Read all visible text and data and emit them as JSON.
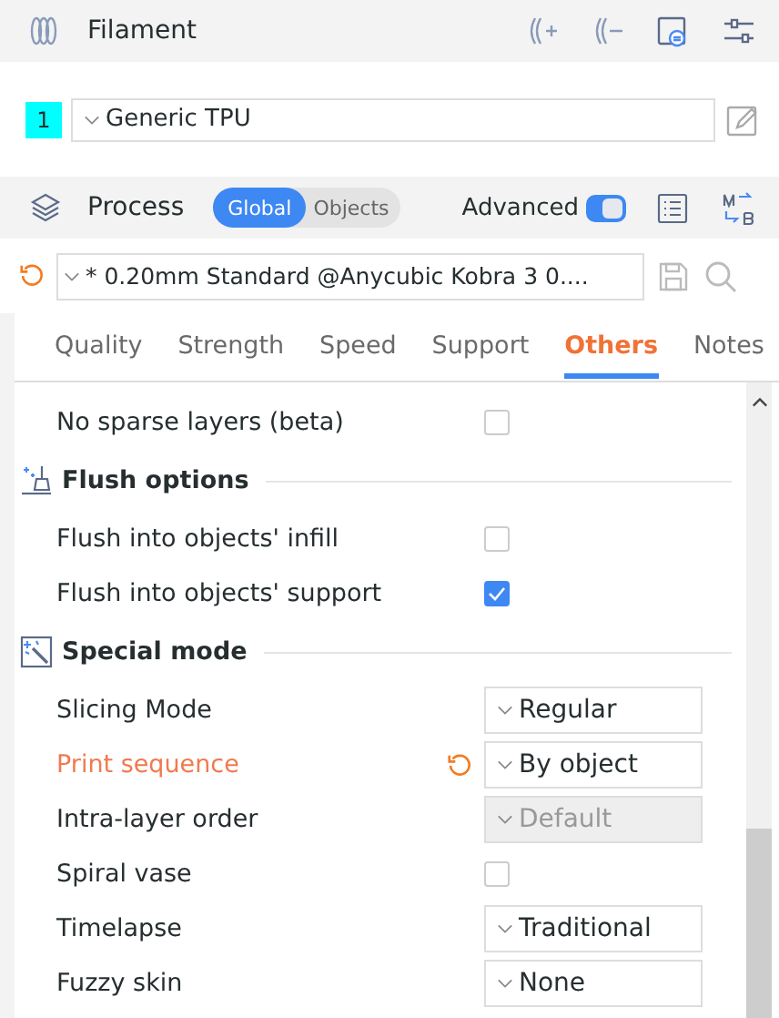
{
  "filament": {
    "title": "Filament",
    "slots": [
      {
        "number": "1",
        "color": "#00ffff",
        "preset": "Generic TPU"
      }
    ]
  },
  "process": {
    "title": "Process",
    "scopes": [
      {
        "label": "Global",
        "selected": true
      },
      {
        "label": "Objects",
        "selected": false
      }
    ],
    "advanced": {
      "label": "Advanced",
      "on": true
    },
    "preset": "* 0.20mm Standard @Anycubic Kobra 3 0...."
  },
  "tabs": [
    {
      "label": "Quality",
      "selected": false
    },
    {
      "label": "Strength",
      "selected": false
    },
    {
      "label": "Speed",
      "selected": false
    },
    {
      "label": "Support",
      "selected": false
    },
    {
      "label": "Others",
      "selected": true
    },
    {
      "label": "Notes",
      "selected": false
    }
  ],
  "settings": [
    {
      "kind": "checkbox",
      "label": "No sparse layers (beta)",
      "checked": false
    },
    {
      "kind": "section",
      "label": "Flush options"
    },
    {
      "kind": "checkbox",
      "label": "Flush into objects' infill",
      "checked": false
    },
    {
      "kind": "checkbox",
      "label": "Flush into objects' support",
      "checked": true
    },
    {
      "kind": "section",
      "label": "Special mode"
    },
    {
      "kind": "select",
      "label": "Slicing Mode",
      "value": "Regular",
      "modified": false,
      "disabled": false
    },
    {
      "kind": "select",
      "label": "Print sequence",
      "value": "By object",
      "modified": true,
      "disabled": false
    },
    {
      "kind": "select",
      "label": "Intra-layer order",
      "value": "Default",
      "modified": false,
      "disabled": true
    },
    {
      "kind": "checkbox",
      "label": "Spiral vase",
      "checked": false
    },
    {
      "kind": "select",
      "label": "Timelapse",
      "value": "Traditional",
      "modified": false,
      "disabled": false
    },
    {
      "kind": "select",
      "label": "Fuzzy skin",
      "value": "None",
      "modified": false,
      "disabled": false
    }
  ]
}
